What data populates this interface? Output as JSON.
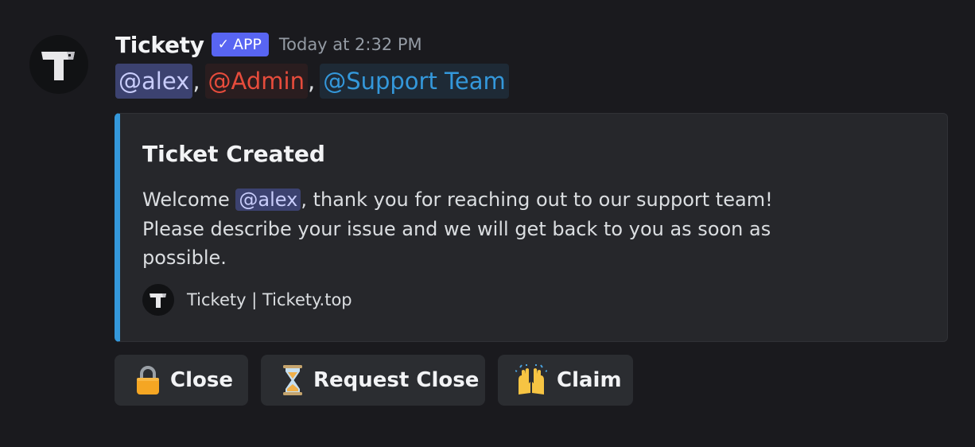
{
  "message": {
    "author": "Tickety",
    "tag": {
      "check": "✓",
      "label": "APP"
    },
    "timestamp": "Today at 2:32 PM",
    "mentions": [
      {
        "text": "@alex",
        "type": "user"
      },
      {
        "text": "@Admin",
        "type": "role",
        "color": "#e74c3c"
      },
      {
        "text": "@Support Team",
        "type": "role",
        "color": "#3498db"
      }
    ],
    "separator": ","
  },
  "embed": {
    "accent_color": "#3498db",
    "title": "Ticket Created",
    "desc_1_before": "Welcome",
    "desc_1_mention": "@alex",
    "desc_1_after": ", thank you for reaching out to our support team!",
    "desc_2": "Please describe your issue and we will get back to you as soon as",
    "desc_3": "possible.",
    "footer_text": "Tickety | Tickety.top"
  },
  "buttons": [
    {
      "label": "Close",
      "icon": "lock-icon"
    },
    {
      "label": "Request Close",
      "icon": "hourglass-icon"
    },
    {
      "label": "Claim",
      "icon": "raised-hands-icon"
    }
  ]
}
